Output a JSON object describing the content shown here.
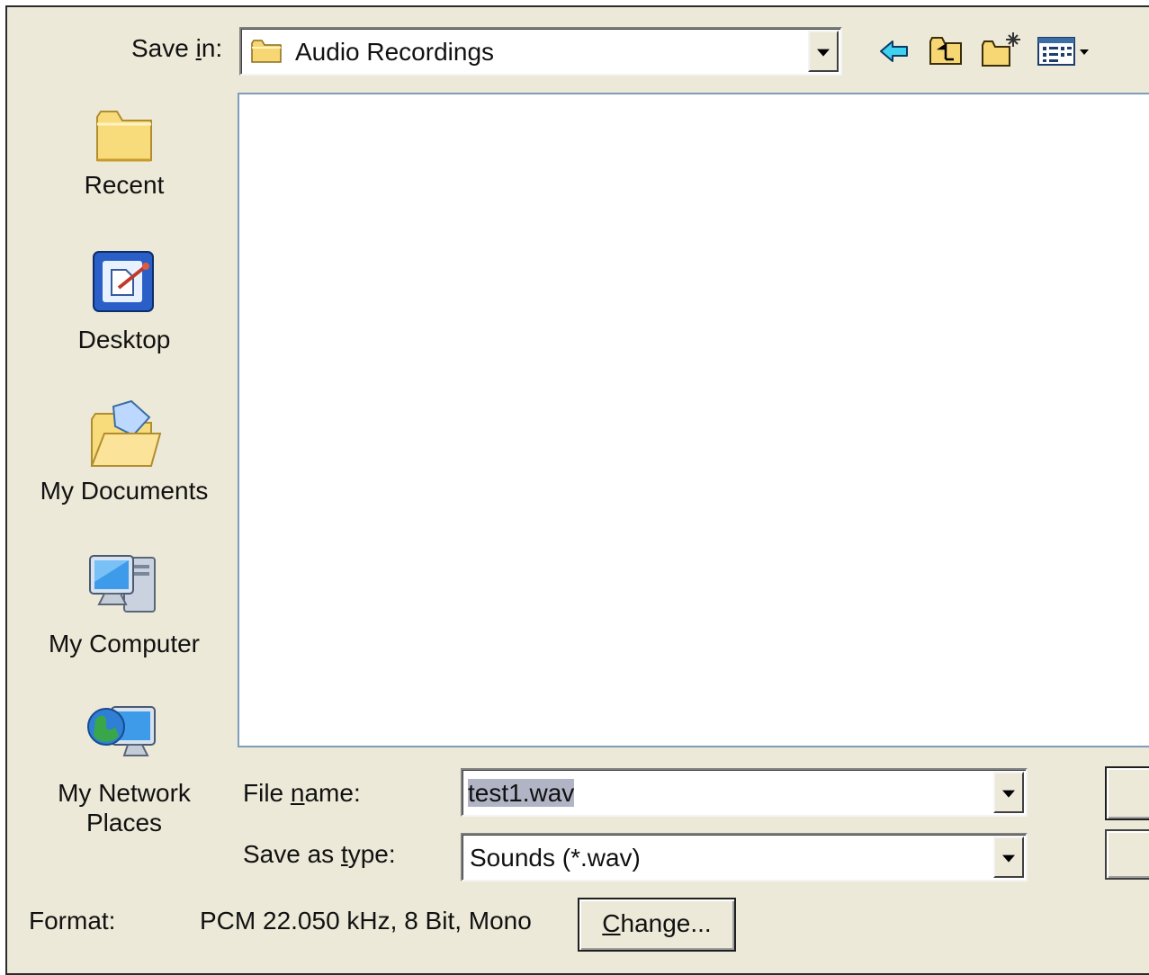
{
  "dialog": {
    "save_in_label_pre": "Save ",
    "save_in_label_ul": "i",
    "save_in_label_post": "n:",
    "save_in_value": "Audio Recordings",
    "toolbar_icons": [
      "back-arrow-icon",
      "up-folder-icon",
      "new-folder-icon",
      "view-menu-icon"
    ]
  },
  "places": {
    "recent": "Recent",
    "desktop": "Desktop",
    "my_documents": "My Documents",
    "my_computer": "My Computer",
    "network_line1": "My Network",
    "network_line2": "Places"
  },
  "form": {
    "file_name_label_pre": "File ",
    "file_name_label_ul": "n",
    "file_name_label_post": "ame:",
    "file_name_value": "test1.wav",
    "save_type_label_pre": "Save as ",
    "save_type_label_ul": "t",
    "save_type_label_post": "ype:",
    "save_type_value": "Sounds (*.wav)"
  },
  "format": {
    "label": "Format:",
    "value": "PCM 22.050 kHz, 8 Bit, Mono",
    "change_ul": "C",
    "change_rest": "hange..."
  },
  "colors": {
    "dialog_bg": "#ece9d8",
    "list_border": "#7f9db9",
    "selection": "#b0b4c4"
  }
}
